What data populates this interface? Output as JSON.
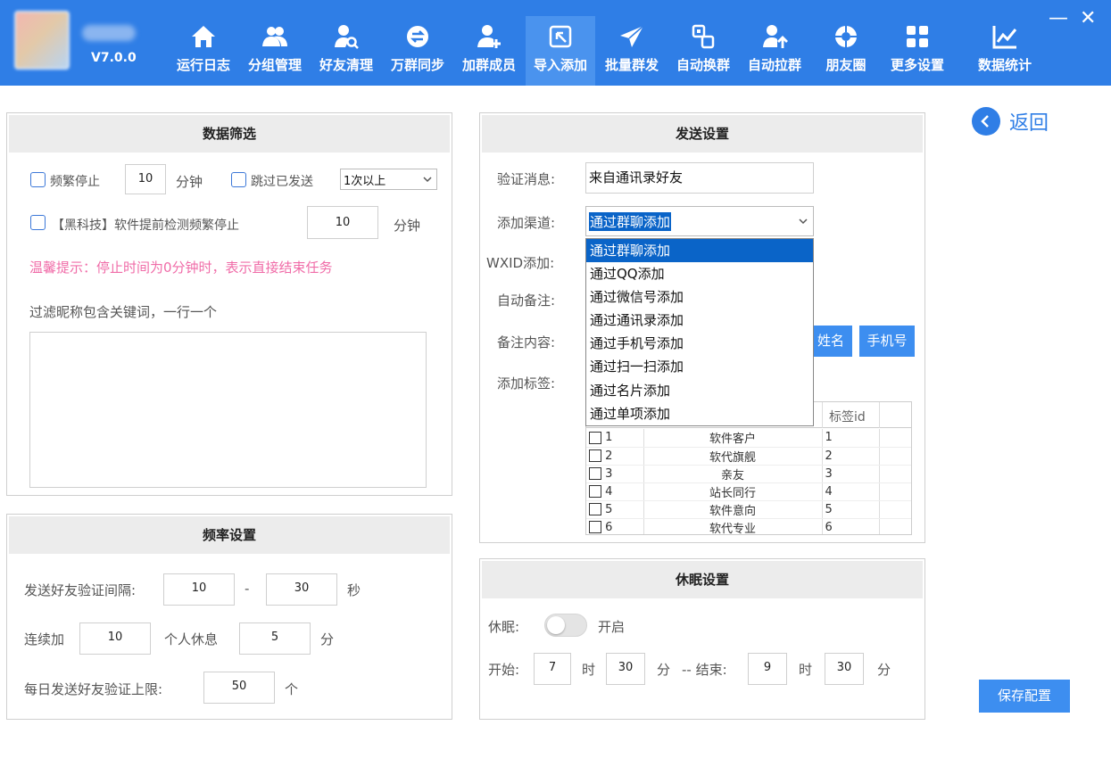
{
  "app": {
    "version": "V7.0.0"
  },
  "nav": [
    {
      "label": "运行日志",
      "icon": "home-icon"
    },
    {
      "label": "分组管理",
      "icon": "group-icon"
    },
    {
      "label": "好友清理",
      "icon": "user-search-icon"
    },
    {
      "label": "万群同步",
      "icon": "sync-icon"
    },
    {
      "label": "加群成员",
      "icon": "user-add-icon"
    },
    {
      "label": "导入添加",
      "icon": "import-icon"
    },
    {
      "label": "批量群发",
      "icon": "send-icon"
    },
    {
      "label": "自动换群",
      "icon": "swap-icon"
    },
    {
      "label": "自动拉群",
      "icon": "user-up-icon"
    },
    {
      "label": "朋友圈",
      "icon": "moments-icon"
    },
    {
      "label": "更多设置",
      "icon": "grid-icon"
    },
    {
      "label": "数据统计",
      "icon": "chart-icon"
    }
  ],
  "window": {
    "minimize": "—",
    "close": "✕"
  },
  "back": {
    "label": "返回"
  },
  "filter": {
    "title": "数据筛选",
    "freq_stop_label": "频繁停止",
    "freq_stop_value": "10",
    "minutes": "分钟",
    "skip_sent_label": "跳过已发送",
    "skip_sent_select": "1次以上",
    "blacktech_label": "【黑科技】软件提前检测频繁停止",
    "blacktech_value": "10",
    "hint": "温馨提示：停止时间为0分钟时，表示直接结束任务",
    "keywords_label": "过滤昵称包含关键词，一行一个",
    "keywords_value": ""
  },
  "rate": {
    "title": "频率设置",
    "interval_label": "发送好友验证间隔:",
    "interval_min": "10",
    "dash": "-",
    "interval_max": "30",
    "seconds": "秒",
    "cont_label": "连续加",
    "cont_value": "10",
    "rest_label": "个人休息",
    "rest_value": "5",
    "rest_unit": "分",
    "daily_label": "每日发送好友验证上限:",
    "daily_value": "50",
    "daily_unit": "个"
  },
  "send": {
    "title": "发送设置",
    "verify_label": "验证消息:",
    "verify_value": "来自通讯录好友",
    "channel_label": "添加渠道:",
    "channel_value": "通过群聊添加",
    "channel_options": [
      "通过群聊添加",
      "通过QQ添加",
      "通过微信号添加",
      "通过通讯录添加",
      "通过手机号添加",
      "通过扫一扫添加",
      "通过名片添加",
      "通过单项添加"
    ],
    "wxid_label": "WXID添加:",
    "remark_label": "自动备注:",
    "remark_content_label": "备注内容:",
    "btn_name": "姓名",
    "btn_phone": "手机号",
    "tag_label": "添加标签:",
    "tag_id_header": "标签id",
    "tags": [
      {
        "no": "1",
        "name": "软件客户",
        "id": "1"
      },
      {
        "no": "2",
        "name": "软代旗舰",
        "id": "2"
      },
      {
        "no": "3",
        "name": "亲友",
        "id": "3"
      },
      {
        "no": "4",
        "name": "站长同行",
        "id": "4"
      },
      {
        "no": "5",
        "name": "软件意向",
        "id": "5"
      },
      {
        "no": "6",
        "name": "软代专业",
        "id": "6"
      }
    ]
  },
  "sleep": {
    "title": "休眠设置",
    "sleep_label": "休眠:",
    "toggle_label": "开启",
    "start_label": "开始:",
    "start_h": "7",
    "hour": "时",
    "start_m": "30",
    "minute": "分",
    "end_label": "-- 结束:",
    "end_h": "9",
    "end_m": "30"
  },
  "save": {
    "label": "保存配置"
  }
}
